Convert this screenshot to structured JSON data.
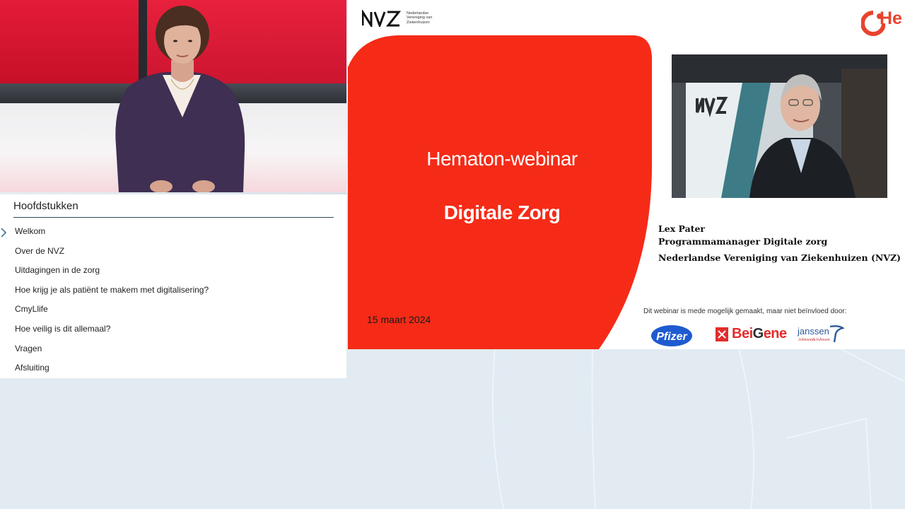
{
  "chapters": {
    "title": "Hoofdstukken",
    "items": [
      {
        "label": "Welkom",
        "active": true
      },
      {
        "label": "Over de NVZ"
      },
      {
        "label": "Uitdagingen in de zorg"
      },
      {
        "label": "Hoe krijg je als patiënt te makem met digitalisering?"
      },
      {
        "label": "CmyLlife"
      },
      {
        "label": "Hoe veilig is dit allemaal?"
      },
      {
        "label": "Vragen"
      },
      {
        "label": "Afsluiting"
      }
    ]
  },
  "slide": {
    "nvz_logo": "NVZ",
    "nvz_line1": "Nederlandse",
    "nvz_line2": "Vereniging van",
    "nvz_line3": "Ziekenhuizen",
    "hematon_logo": "He",
    "title": "Hematon-webinar",
    "subtitle": "Digitale Zorg",
    "date": "15 maart 2024",
    "speaker": {
      "name": "Lex Pater",
      "role": "Programmamanager Digitale zorg",
      "organization": "Nederlandse Vereniging van Ziekenhuizen (NVZ)"
    },
    "sponsor_note": "Dit webinar is mede mogelijk gemaakt, maar niet beïnvloed door:",
    "sponsors": {
      "pfizer": "Pfizer",
      "beigene_a": "Bei",
      "beigene_b": "G",
      "beigene_c": "ene",
      "janssen": "janssen",
      "janssen_sub": "Johnson&Johnson"
    }
  },
  "colors": {
    "slide_red": "#f52b18",
    "background": "#e1ebf1",
    "hematon_orange": "#e8432e",
    "nav_accent": "#2c4a5a"
  }
}
